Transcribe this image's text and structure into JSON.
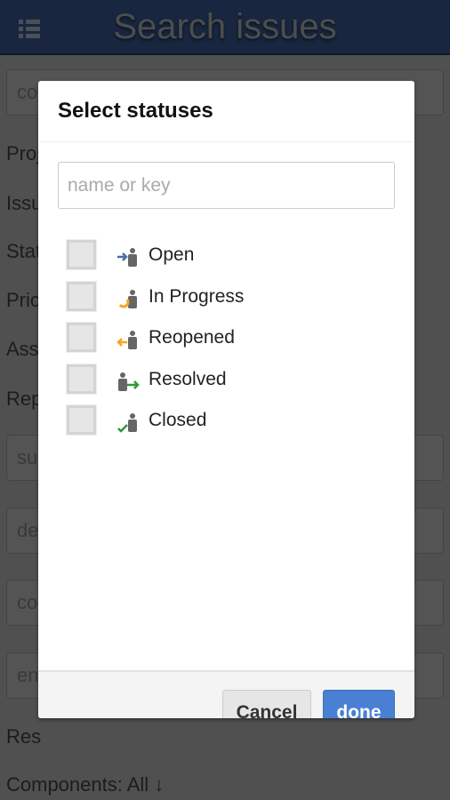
{
  "header": {
    "title": "Search issues",
    "menu_icon": "list-icon",
    "bg_color": "#18273f"
  },
  "background": {
    "inputs": [
      "co",
      "su",
      "de",
      "co",
      "en"
    ],
    "labels": [
      "Proj",
      "Issu",
      "Stat",
      "Pric",
      "Ass",
      "Rep",
      "Res",
      "Components: All ↓"
    ]
  },
  "dialog": {
    "title": "Select statuses",
    "search_placeholder": "name or key",
    "search_value": "",
    "statuses": [
      {
        "label": "Open",
        "icon": "status-open-icon",
        "checked": false,
        "color": "#4a6ea0"
      },
      {
        "label": "In Progress",
        "icon": "status-in-progress-icon",
        "checked": false,
        "color": "#f5a623"
      },
      {
        "label": "Reopened",
        "icon": "status-reopened-icon",
        "checked": false,
        "color": "#f5a623"
      },
      {
        "label": "Resolved",
        "icon": "status-resolved-icon",
        "checked": false,
        "color": "#2e9a3a"
      },
      {
        "label": "Closed",
        "icon": "status-closed-icon",
        "checked": false,
        "color": "#2e9a3a"
      }
    ],
    "cancel_label": "Cancel",
    "done_label": "done",
    "accent": "#4a80d4"
  }
}
